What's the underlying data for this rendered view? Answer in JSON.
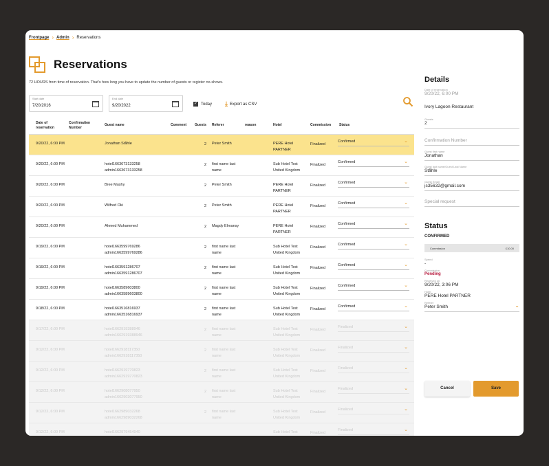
{
  "breadcrumb": {
    "items": [
      {
        "label": "Frontpage"
      },
      {
        "label": "Admin"
      },
      {
        "label": "Reservations"
      }
    ]
  },
  "page": {
    "title": "Reservations",
    "subtitle": "72 HOURS from time of reservation. That's how long you have to update the number of guests or register no-shows."
  },
  "filters": {
    "start_label": "Start date",
    "start_value": "7/20/2016",
    "end_label": "End date",
    "end_value": "9/20/2022",
    "today_label": "Today",
    "today_checked": true,
    "export_label": "Export as CSV"
  },
  "table": {
    "headers": {
      "date": "Date of reservation",
      "conf": "Confirmation Number",
      "guest": "Guest name",
      "comment": "Comment",
      "guests": "Guests",
      "referer": "Referer",
      "reason": "reason",
      "hotel": "Hotel",
      "commission": "Commission",
      "status": "Status"
    },
    "rows": [
      {
        "date": "9/20/22, 6:00 PM",
        "guest": "Jonathan Ståhle",
        "guests": "2",
        "referer": "Peter Smith",
        "hotel": "PERE Hotel PARTNER",
        "commission": "Finalized",
        "status": "Confirmed"
      },
      {
        "date": "9/20/22, 6:00 PM",
        "guest": "hotel1663673133258 admin1663673133258",
        "guests": "2",
        "referer": "first name last name",
        "hotel": "Sub Hotel Test United Kingdom",
        "commission": "Finalized",
        "status": "Confirmed"
      },
      {
        "date": "9/20/22, 6:00 PM",
        "guest": "Bree Mushy",
        "guests": "2",
        "referer": "Peter Smith",
        "hotel": "PERE Hotel PARTNER",
        "commission": "Finalized",
        "status": "Confirmed"
      },
      {
        "date": "9/20/22, 6:00 PM",
        "guest": "Wilfred Oki",
        "guests": "2",
        "referer": "Peter Smith",
        "hotel": "PERE Hotel PARTNER",
        "commission": "Finalized",
        "status": "Confirmed"
      },
      {
        "date": "9/20/22, 6:00 PM",
        "guest": "Ahmed Muhammed",
        "guests": "2",
        "referer": "Magdy Elmansy",
        "hotel": "PERE Hotel PARTNER",
        "commission": "Finalized",
        "status": "Confirmed"
      },
      {
        "date": "9/19/22, 6:00 PM",
        "guest": "hotel1663599769286 admin1663599769286",
        "guests": "2",
        "referer": "first name last name",
        "hotel": "Sub Hotel Test United Kingdom",
        "commission": "Finalized",
        "status": "Confirmed"
      },
      {
        "date": "9/19/22, 6:00 PM",
        "guest": "hotel1663591286707 admin1663591286707",
        "guests": "2",
        "referer": "first name last name",
        "hotel": "Sub Hotel Test United Kingdom",
        "commission": "Finalized",
        "status": "Confirmed"
      },
      {
        "date": "9/19/22, 6:00 PM",
        "guest": "hotel1663589603800 admin1663589603800",
        "guests": "2",
        "referer": "first name last name",
        "hotel": "Sub Hotel Test United Kingdom",
        "commission": "Finalized",
        "status": "Confirmed"
      },
      {
        "date": "9/18/22, 6:00 PM",
        "guest": "hotel1663516816937 admin1663516816937",
        "guests": "2",
        "referer": "first name last name",
        "hotel": "Sub Hotel Test United Kingdom",
        "commission": "Finalized",
        "status": "Confirmed"
      },
      {
        "date": "9/17/22, 6:00 PM",
        "guest": "hotel1662919388946 admin1662919388946",
        "guests": "2",
        "referer": "first name last name",
        "hotel": "Sub Hotel Test United Kingdom",
        "commission": "Finalized",
        "status": "Finalized"
      },
      {
        "date": "9/12/22, 6:00 PM",
        "guest": "hotel1662918117350 admin1662918117350",
        "guests": "2",
        "referer": "first name last name",
        "hotel": "Sub Hotel Test United Kingdom",
        "commission": "Finalized",
        "status": "Finalized"
      },
      {
        "date": "9/12/22, 6:00 PM",
        "guest": "hotel1662919770823 admin1662919770823",
        "guests": "2",
        "referer": "first name last name",
        "hotel": "Sub Hotel Test United Kingdom",
        "commission": "Finalized",
        "status": "Finalized"
      },
      {
        "date": "9/12/22, 6:00 PM",
        "guest": "hotel1662908077950 admin1662903077950",
        "guests": "2",
        "referer": "first name last name",
        "hotel": "Sub Hotel Test United Kingdom",
        "commission": "Finalized",
        "status": "Finalized"
      },
      {
        "date": "9/12/22, 6:00 PM",
        "guest": "hotel1662989032268 admin1662989032268",
        "guests": "2",
        "referer": "first name last name",
        "hotel": "Sub Hotel Test United Kingdom",
        "commission": "Finalized",
        "status": "Finalized"
      },
      {
        "date": "9/12/22, 6:00 PM",
        "guest": "hotel1662979454940",
        "guests": "",
        "referer": "",
        "hotel": "Sub Hotel Test",
        "commission": "Finalized",
        "status": "Finalized"
      }
    ]
  },
  "details": {
    "title": "Details",
    "date_label": "Date of reservation",
    "date_value": "9/20/22, 6:00 PM",
    "restaurant": "Ivory Lagoon Restaurant",
    "guests_label": "Guests",
    "guests_value": "2",
    "confirmation_placeholder": "Confirmation Number",
    "first_name_label": "Guest first name",
    "first_name_value": "Jonathan",
    "last_name_label": "Guest last name/Guest Last Name",
    "last_name_value": "Ståhle",
    "email_label": "Guest Email",
    "email_value": "js35632@gmail.com",
    "special_request_placeholder": "Special request"
  },
  "status_panel": {
    "title": "Status",
    "state": "CONFIRMED",
    "commission_label": "Commission",
    "commission_value": "£10.00",
    "spend_label": "Spend",
    "spend_value": "-",
    "commission_status_label": "Commission",
    "commission_status_value": "Pending",
    "received_label": "Received on",
    "received_value": "9/20/22, 3:06 PM",
    "hotel_label": "Hotel",
    "hotel_value": "PERE Hotel PARTNER",
    "referer_label": "Referer",
    "referer_value": "Peter Smith"
  },
  "actions": {
    "cancel": "Cancel",
    "save": "Save"
  },
  "colors": {
    "accent": "#e39a2d",
    "selected_row": "#fbe38d",
    "pending": "#b5173a",
    "background": "#2b2826"
  },
  "icons": {
    "search": "search-icon",
    "calendar": "calendar-icon",
    "download": "download-icon",
    "chevron": "chevron-down-icon"
  }
}
